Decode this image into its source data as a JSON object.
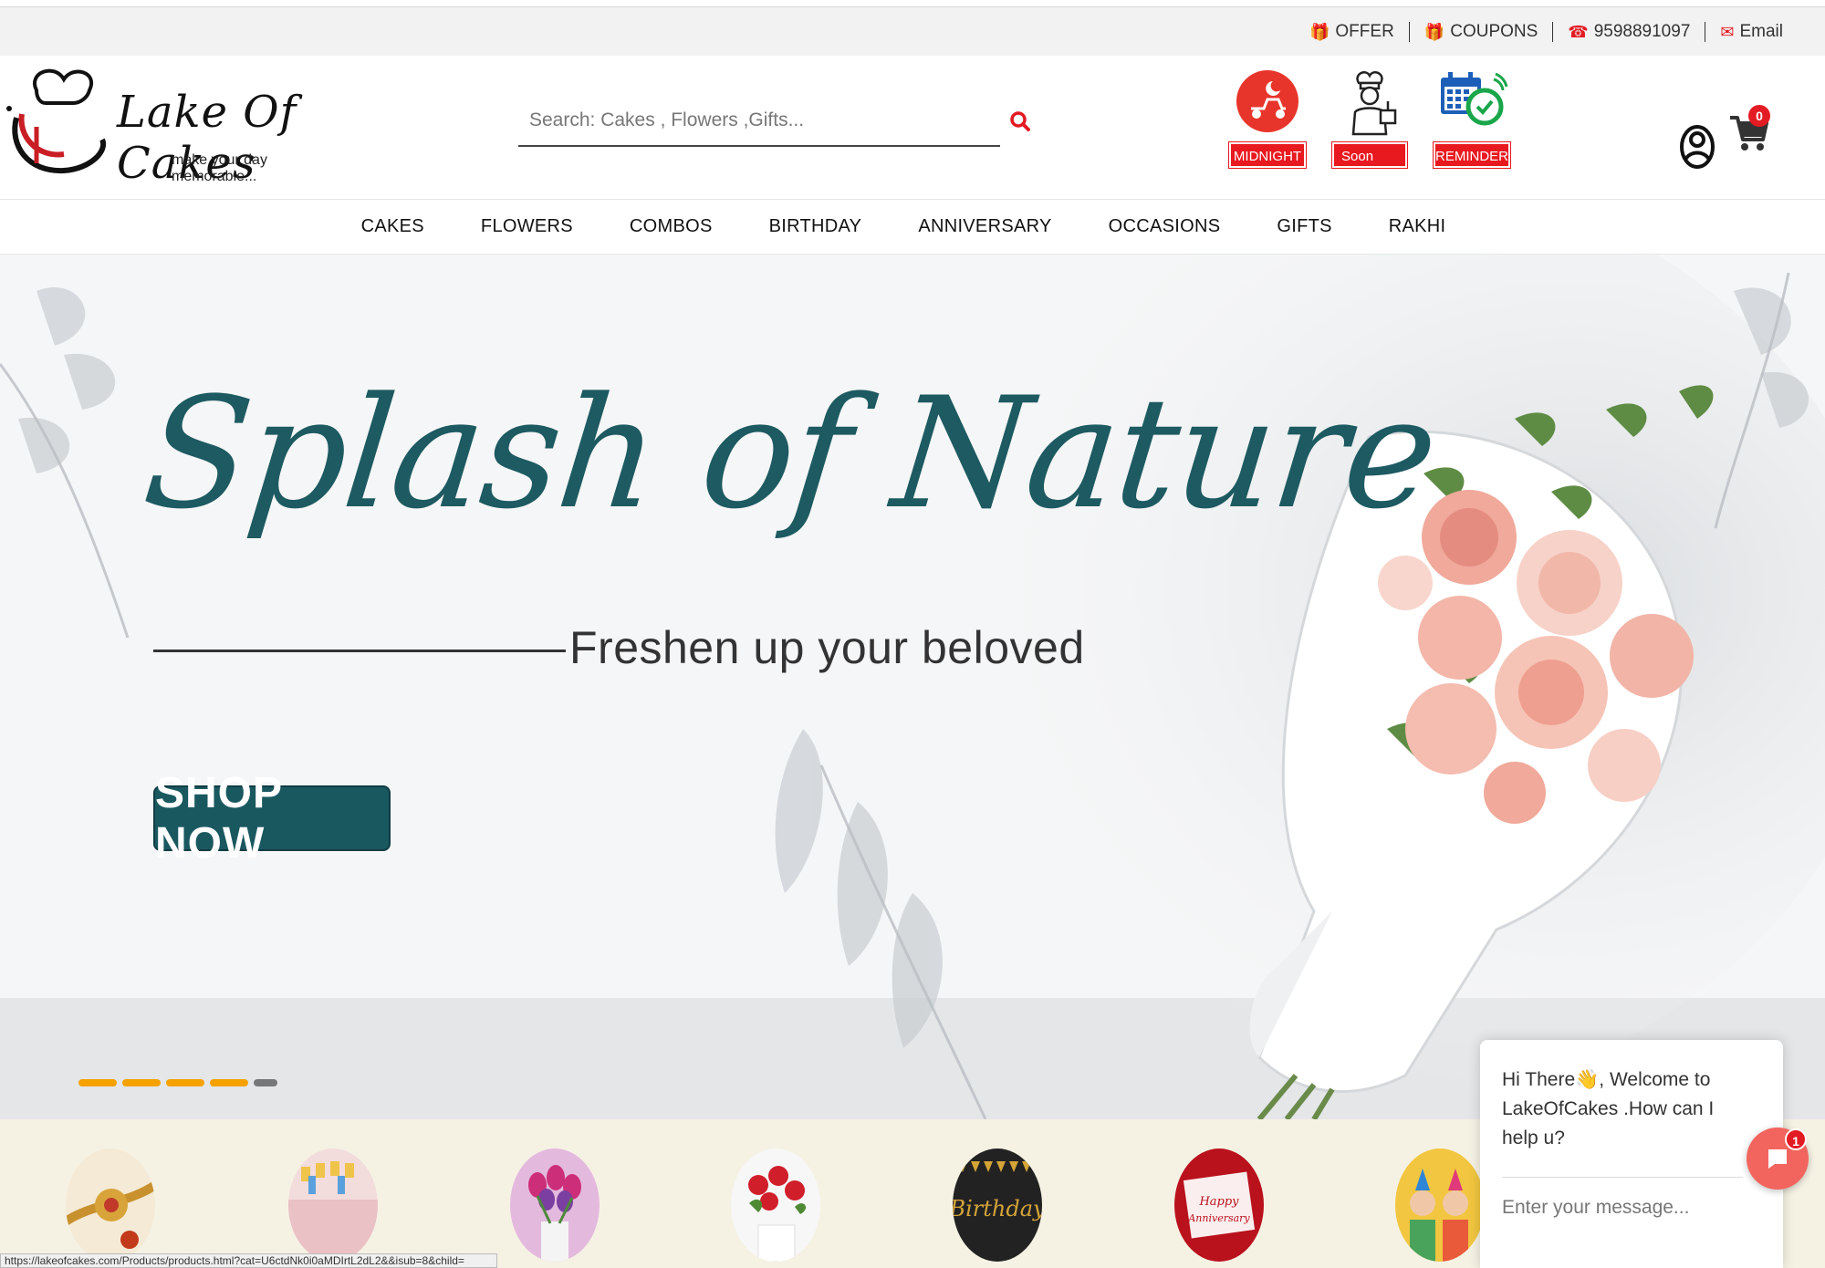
{
  "topbar": {
    "offer": "OFFER",
    "coupons": "COUPONS",
    "phone": "9598891097",
    "email": "Email"
  },
  "logo": {
    "title": "Lake Of Cakes",
    "tagline": "make your day memorable..."
  },
  "search": {
    "placeholder": "Search: Cakes , Flowers ,Gifts..."
  },
  "quick_links": [
    {
      "label": "MIDNIGHT",
      "icon": "midnight-delivery-icon"
    },
    {
      "label": "Soon",
      "icon": "chef-icon"
    },
    {
      "label": "REMINDER",
      "icon": "calendar-alarm-icon"
    }
  ],
  "cart": {
    "count": "0"
  },
  "nav": {
    "items": [
      "CAKES",
      "FLOWERS",
      "COMBOS",
      "BIRTHDAY",
      "ANNIVERSARY",
      "OCCASIONS",
      "GIFTS",
      "RAKHI"
    ]
  },
  "hero": {
    "title": "Splash of Nature",
    "subtitle": "Freshen up your beloved",
    "cta": "SHOP NOW",
    "slides_total": 5,
    "active_slide": 4
  },
  "categories": [
    {
      "icon": "rakhi-image"
    },
    {
      "icon": "birthday-cake-image"
    },
    {
      "icon": "tulips-image"
    },
    {
      "icon": "roses-image"
    },
    {
      "icon": "birthday-image"
    },
    {
      "icon": "anniversary-image"
    },
    {
      "icon": "kids-party-image"
    }
  ],
  "status_url": "https://lakeofcakes.com/Products/products.html?cat=U6ctdNk0i0aMDIrtL2dL2&&isub=8&child=",
  "chat": {
    "message": "Hi There👋, Welcome to LakeOfCakes .How can I help u?",
    "placeholder": "Enter your message...",
    "badge": "1"
  },
  "colors": {
    "brand_red": "#e31b23",
    "hero_teal": "#1d5a61",
    "slider_active": "#f5a100",
    "chat_button": "#f2655e"
  }
}
